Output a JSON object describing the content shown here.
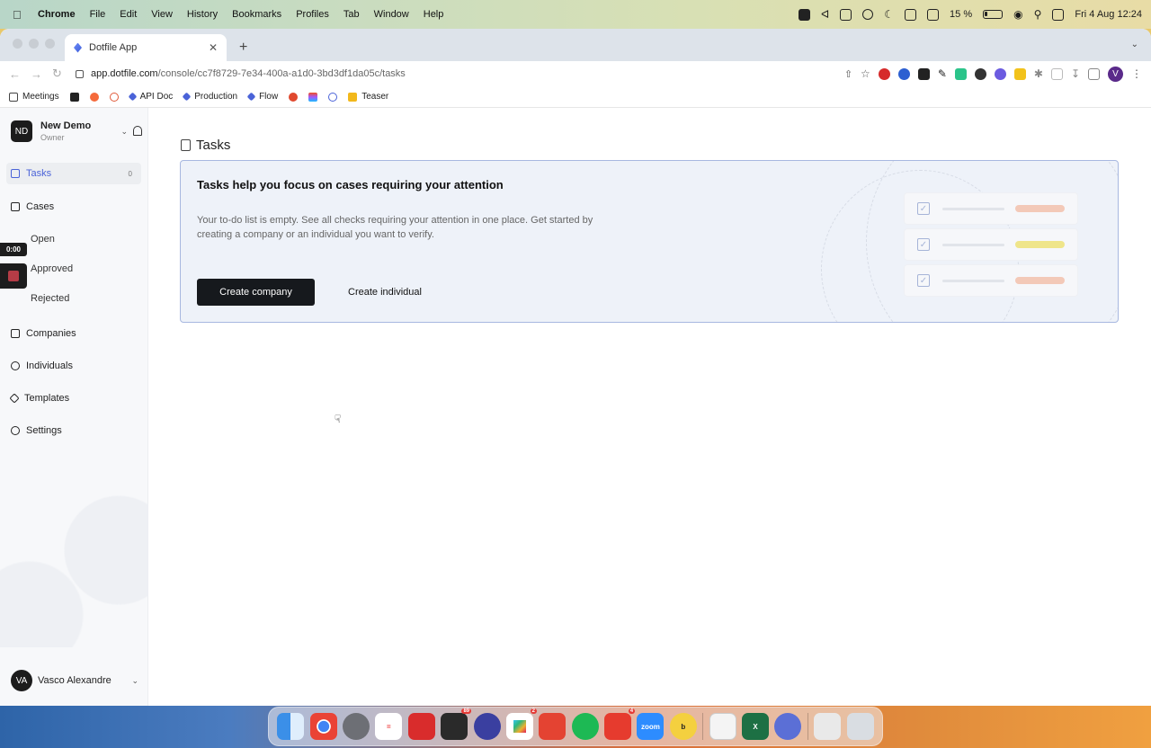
{
  "menubar": {
    "app": "Chrome",
    "items": [
      "File",
      "Edit",
      "View",
      "History",
      "Bookmarks",
      "Profiles",
      "Tab",
      "Window",
      "Help"
    ],
    "battery": "15 %",
    "clock": "Fri 4 Aug  12:24"
  },
  "browser": {
    "tab_title": "Dotfile App",
    "url_host": "app.dotfile.com",
    "url_path": "/console/cc7f8729-7e34-400a-a1d0-3bd3df1da05c/tasks",
    "profile_initial": "V",
    "bookmarks": [
      "Meetings",
      "API Doc",
      "Production",
      "Flow",
      "Teaser"
    ]
  },
  "sidebar": {
    "org_initials": "ND",
    "org_name": "New Demo",
    "org_role": "Owner",
    "tasks_label": "Tasks",
    "tasks_count": "0",
    "cases_label": "Cases",
    "case_sub": [
      "Open",
      "Approved",
      "Rejected"
    ],
    "companies_label": "Companies",
    "individuals_label": "Individuals",
    "templates_label": "Templates",
    "settings_label": "Settings",
    "user_initials": "VA",
    "user_name": "Vasco Alexandre"
  },
  "main": {
    "title": "Tasks",
    "card_heading": "Tasks help you focus on cases requiring your attention",
    "card_text": "Your to-do list is empty. See all checks requiring your attention in one place. Get started by creating a company or an individual you want to verify.",
    "create_company": "Create company",
    "create_individual": "Create individual"
  },
  "recording": {
    "time": "0:00"
  },
  "colors": {
    "accent": "#4a63d8",
    "primary_button": "#16191d",
    "card_border": "#a8b8e0",
    "card_bg": "#eef2f9",
    "pill_red": "#f3c9b8",
    "pill_yellow": "#efe58a"
  },
  "dock": {
    "badges": [
      "89",
      "2",
      "4"
    ]
  }
}
